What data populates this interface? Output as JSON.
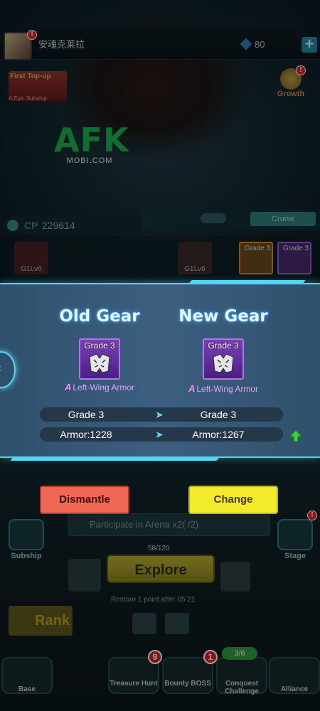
{
  "header": {
    "player_name": "安魂克莱拉",
    "gems": "80",
    "plus": "+",
    "avatar_alert": "!"
  },
  "promo": {
    "first_topup_title": "First Top-up",
    "first_topup_sub": "A Epic Subship",
    "growth_label": "Growth",
    "growth_alert": "!"
  },
  "watermark": {
    "big": "AFK",
    "small": "MOBI.COM"
  },
  "combat_power": {
    "label": "CP",
    "value": "229614"
  },
  "cruise_label": "Cruise",
  "equip_slots": [
    {
      "label": "G1Lv6",
      "grade": ""
    },
    {
      "label": "G1Lv6",
      "grade": ""
    },
    {
      "label": "",
      "grade": "Grade 3"
    },
    {
      "label": "",
      "grade": "Grade 3"
    }
  ],
  "dialog": {
    "old_title": "Old Gear",
    "new_title": "New Gear",
    "old_item": {
      "grade": "Grade 3",
      "rarity": "A",
      "name": "Left-Wing Armor"
    },
    "new_item": {
      "grade": "Grade 3",
      "rarity": "A",
      "name": "Left-Wing Armor"
    },
    "stats": [
      {
        "old": "Grade 3",
        "new": "Grade 3"
      },
      {
        "old": "Armor:1228",
        "new": "Armor:1267"
      }
    ],
    "arrow": "➤"
  },
  "actions": {
    "dismantle": "Dismantle",
    "change": "Change"
  },
  "home": {
    "arena_task": "Participate in Arena x2(   /2)",
    "energy": "58/120",
    "explore": "Explore",
    "restore": "Restore 1 point after 05:21",
    "subship": "Subship",
    "stage": "Stage",
    "stage_alert": "!",
    "rank": "Rank"
  },
  "nav": [
    {
      "label": "Base"
    },
    {
      "label": "Treasure Hunt",
      "badge": "9"
    },
    {
      "label": "Bounty BOSS",
      "badge": "1"
    },
    {
      "label": "Conquest Challenge",
      "badge": "3/6"
    },
    {
      "label": "Alliance"
    }
  ],
  "colors": {
    "dismantle": "#ee6852",
    "change": "#f3ea2c",
    "dialog_border": "#4fd6ef",
    "epic_purple": "#7a3fb8",
    "upgrade_green": "#3fd13f"
  }
}
